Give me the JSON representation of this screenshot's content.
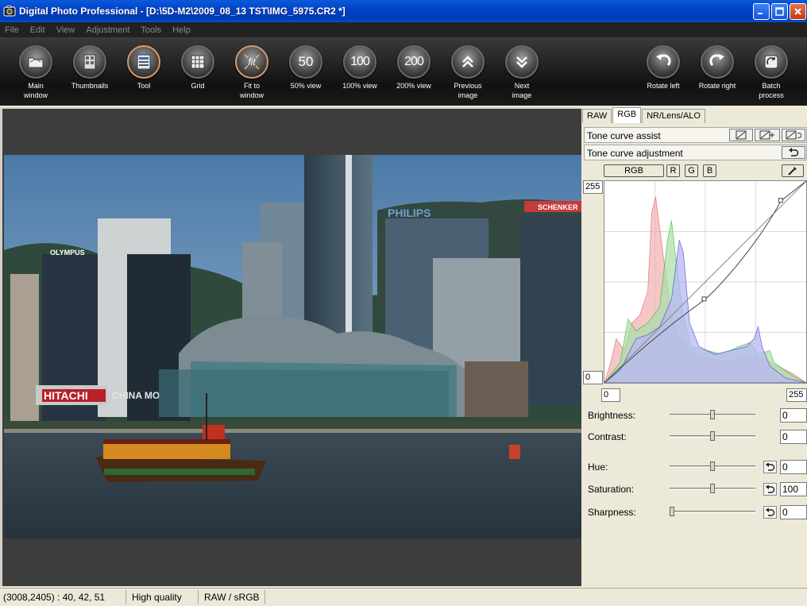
{
  "window": {
    "title": "Digital Photo Professional - [D:\\5D-M2\\2009_08_13 TST\\IMG_5975.CR2 *]"
  },
  "menu": [
    "File",
    "Edit",
    "View",
    "Adjustment",
    "Tools",
    "Help"
  ],
  "toolbar": {
    "main_window": [
      "Main",
      "window"
    ],
    "thumbnails": [
      "Thumbnails"
    ],
    "tool": [
      "Tool"
    ],
    "grid": [
      "Grid"
    ],
    "fit": [
      "Fit to",
      "window"
    ],
    "fit_glyph": "fit",
    "v50": [
      "50% view"
    ],
    "v50_glyph": "50",
    "v100": [
      "100% view"
    ],
    "v100_glyph": "100",
    "v200": [
      "200% view"
    ],
    "v200_glyph": "200",
    "prev": [
      "Previous",
      "image"
    ],
    "next": [
      "Next",
      "image"
    ],
    "rot_left": [
      "Rotate left"
    ],
    "rot_right": [
      "Rotate right"
    ],
    "batch": [
      "Batch",
      "process"
    ]
  },
  "photo": {
    "signs": {
      "philips": "PHILIPS",
      "schenker": "SCHENKER",
      "olympus": "OLYMPUS",
      "hitachi": "HITACHI",
      "china": "CHINA MO"
    }
  },
  "panel": {
    "tabs": [
      "RAW",
      "RGB",
      "NR/Lens/ALO"
    ],
    "selected_tab": "RGB",
    "tone_curve_assist": "Tone curve assist",
    "tone_curve_adjustment": "Tone curve adjustment",
    "channels": {
      "rgb": "RGB",
      "r": "R",
      "g": "G",
      "b": "B"
    },
    "graph": {
      "y_max": "255",
      "y_min": "0",
      "x_min": "0",
      "x_max": "255"
    },
    "sliders": {
      "brightness": {
        "label": "Brightness:",
        "value": "0",
        "level": 0.5
      },
      "contrast": {
        "label": "Contrast:",
        "value": "0",
        "level": 0.5
      },
      "hue": {
        "label": "Hue:",
        "value": "0",
        "level": 0.5
      },
      "saturation": {
        "label": "Saturation:",
        "value": "100",
        "level": 0.5
      },
      "sharpness": {
        "label": "Sharpness:",
        "value": "0",
        "level": 0.0
      }
    }
  },
  "status": {
    "coords": "(3008,2405) :  40, 42, 51",
    "quality": "High quality",
    "mode": "RAW / sRGB"
  },
  "colors": {
    "titlebar": "#0143c7",
    "toolbar": "#1a1a1a",
    "panel": "#ece9d8",
    "viewer": "#3d3d3d"
  }
}
